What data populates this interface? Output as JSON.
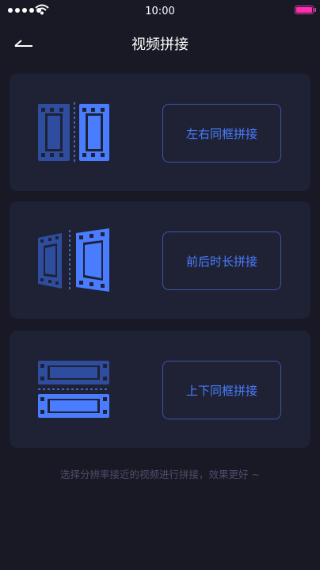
{
  "status_bar": {
    "time": "10:00",
    "battery_color": "#ff2fae"
  },
  "nav": {
    "back_icon": "back-arrow-icon",
    "title": "视频拼接"
  },
  "options": [
    {
      "label": "左右同框拼接",
      "icon": "side-by-side-film-icon"
    },
    {
      "label": "前后时长拼接",
      "icon": "sequential-film-icon"
    },
    {
      "label": "上下同框拼接",
      "icon": "stacked-film-icon"
    }
  ],
  "tip": "选择分辨率接近的视频进行拼接，效果更好 ~",
  "colors": {
    "background": "#191926",
    "card": "#1f2235",
    "accent": "#4a7cff",
    "accent_dark": "#2f4d9e",
    "button_border": "#3b56a8",
    "tip_text": "#4b4e66"
  }
}
